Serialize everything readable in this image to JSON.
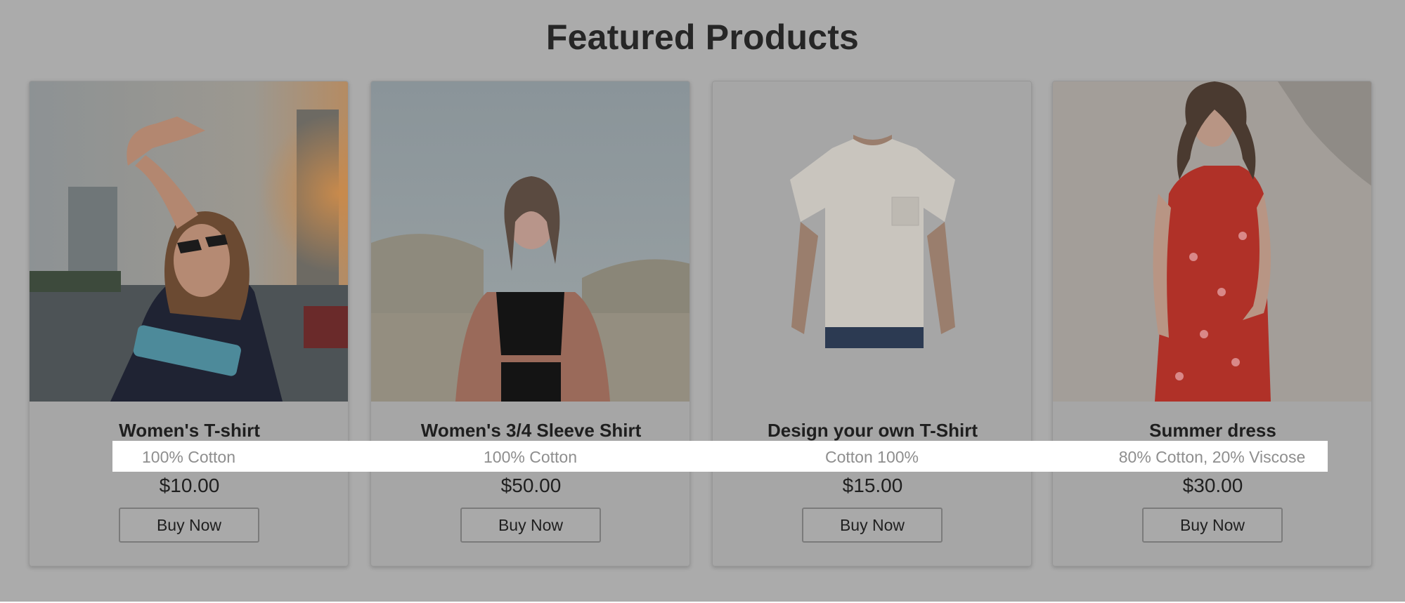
{
  "page": {
    "title": "Featured Products"
  },
  "products": [
    {
      "name": "Women's T-shirt",
      "material": "100% Cotton",
      "price": "$10.00",
      "button_label": "Buy Now",
      "image": "woman-sunglasses-photo"
    },
    {
      "name": "Women's 3/4 Sleeve Shirt",
      "material": "100% Cotton",
      "price": "$50.00",
      "button_label": "Buy Now",
      "image": "woman-desert-photo"
    },
    {
      "name": "Design your own T-Shirt",
      "material": "Cotton 100%",
      "price": "$15.00",
      "button_label": "Buy Now",
      "image": "white-tshirt-photo"
    },
    {
      "name": "Summer dress",
      "material": "80% Cotton, 20% Viscose",
      "price": "$30.00",
      "button_label": "Buy Now",
      "image": "red-dress-photo"
    }
  ],
  "colors": {
    "overlay": "#ababab",
    "highlight": "#ffffff",
    "text_dark": "#1f1f1f",
    "text_muted": "#8a8a8a"
  }
}
